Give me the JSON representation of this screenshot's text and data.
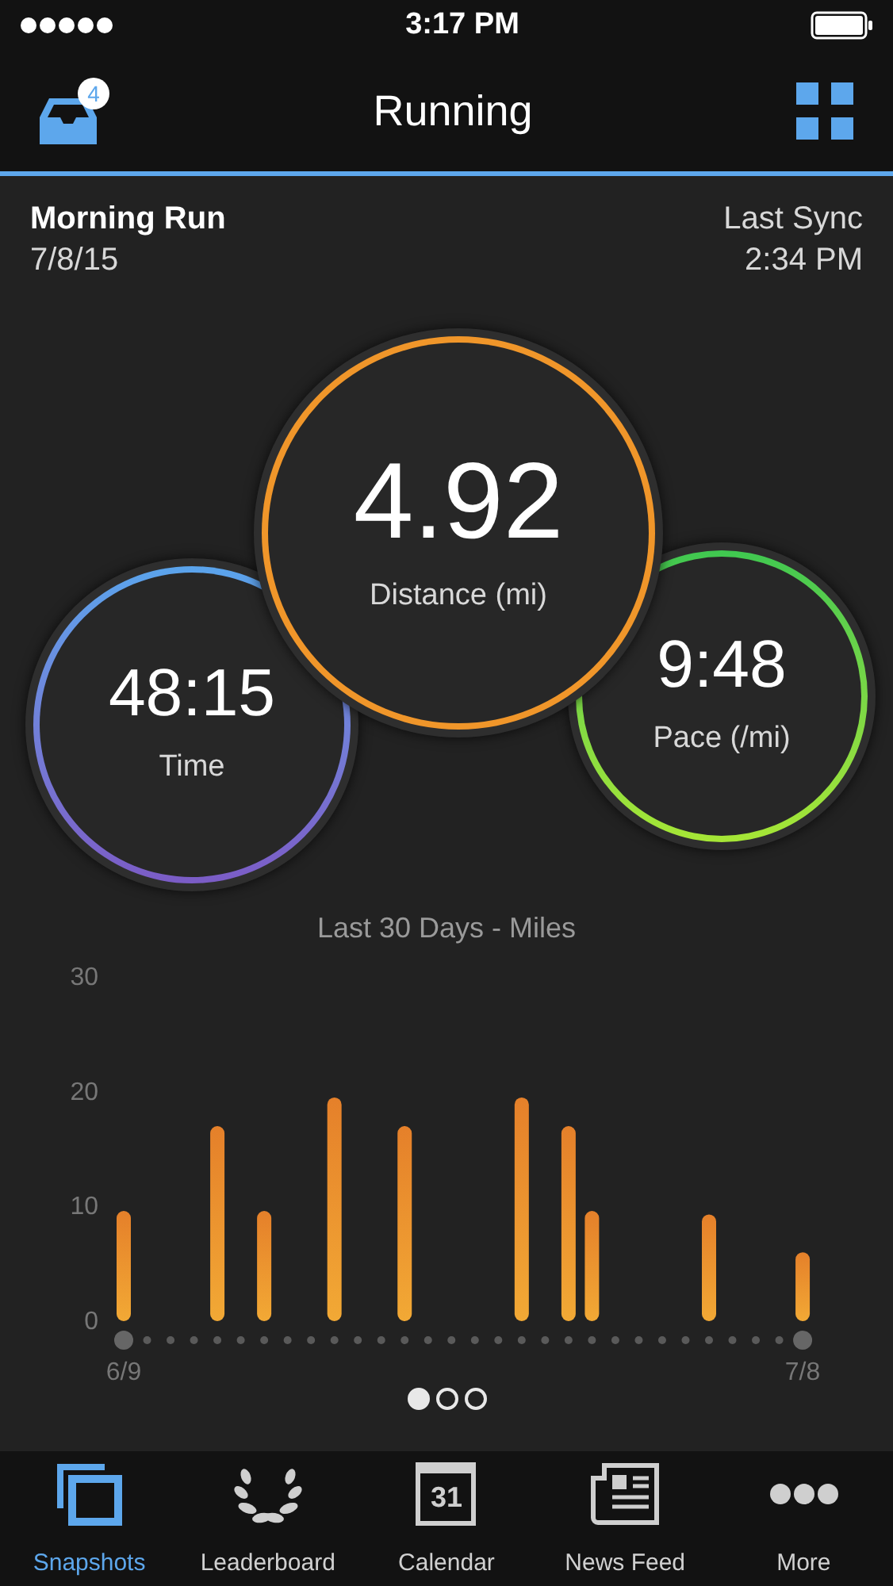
{
  "status_bar": {
    "time": "3:17 PM"
  },
  "header": {
    "title": "Running",
    "inbox_badge": "4"
  },
  "activity": {
    "name": "Morning Run",
    "date": "7/8/15",
    "sync_label": "Last Sync",
    "sync_time": "2:34 PM"
  },
  "stats": [
    {
      "kind": "distance",
      "value": "4.92",
      "label": "Distance (mi)"
    },
    {
      "kind": "time",
      "value": "48:15",
      "label": "Time"
    },
    {
      "kind": "pace",
      "value": "9:48",
      "label": "Pace (/mi)"
    }
  ],
  "chart": {
    "chart_data": {
      "type": "bar",
      "title": "Last 30 Days - Miles",
      "categories": [
        "6/9",
        null,
        null,
        null,
        null,
        null,
        null,
        null,
        null,
        null,
        null,
        null,
        null,
        null,
        null,
        null,
        null,
        null,
        null,
        null,
        null,
        null,
        null,
        null,
        null,
        null,
        null,
        null,
        null,
        "7/8"
      ],
      "values": [
        9.6,
        0,
        0,
        0,
        17,
        0,
        9.6,
        0,
        0,
        19.5,
        0,
        0,
        17,
        0,
        0,
        0,
        0,
        19.5,
        0,
        17,
        9.6,
        0,
        0,
        0,
        0,
        9.3,
        0,
        0,
        0,
        6
      ],
      "ylim": [
        0,
        30
      ],
      "yticks": [
        0,
        10,
        20,
        30
      ]
    }
  },
  "pager": [
    {
      "selected": true
    },
    {
      "selected": false
    },
    {
      "selected": false
    }
  ],
  "tabs": [
    {
      "label": "Snapshots",
      "selected": true
    },
    {
      "label": "Leaderboard",
      "selected": false
    },
    {
      "label": "Calendar",
      "selected": false,
      "icon_text": "31"
    },
    {
      "label": "News Feed",
      "selected": false
    },
    {
      "label": "More",
      "selected": false
    }
  ]
}
